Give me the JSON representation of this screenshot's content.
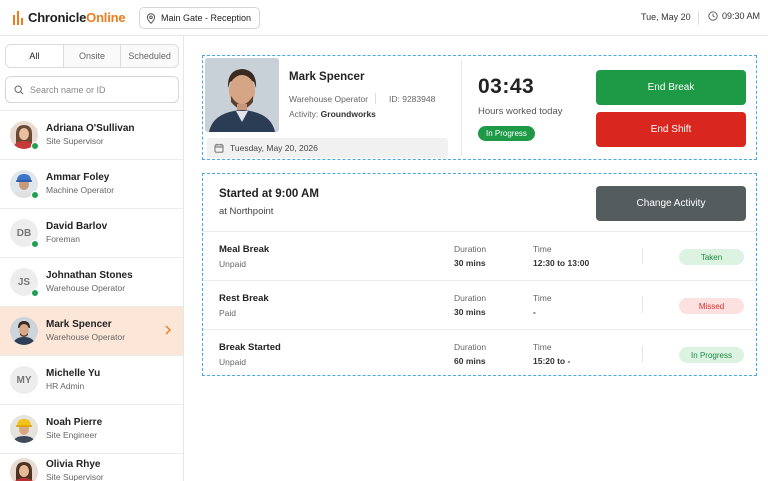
{
  "header": {
    "brand_prefix": "Chronicle",
    "brand_suffix": "Online",
    "location": "Main Gate - Reception",
    "date": "Tue, May 20",
    "time": "09:30 AM"
  },
  "sidebar": {
    "tabs": [
      {
        "label": "All"
      },
      {
        "label": "Onsite"
      },
      {
        "label": "Scheduled"
      }
    ],
    "search_placeholder": "Search name or ID",
    "employees": [
      {
        "name": "Adriana O'Sullivan",
        "role": "Site Supervisor"
      },
      {
        "name": "Ammar Foley",
        "role": "Machine Operator"
      },
      {
        "name": "David Barlov",
        "role": "Foreman",
        "initials": "DB"
      },
      {
        "name": "Johnathan Stones",
        "role": "Warehouse Operator",
        "initials": "JS"
      },
      {
        "name": "Mark Spencer",
        "role": "Warehouse Operator"
      },
      {
        "name": "Michelle Yu",
        "role": "HR Admin",
        "initials": "MY"
      },
      {
        "name": "Noah Pierre",
        "role": "Site Engineer"
      },
      {
        "name": "Olivia Rhye",
        "role": "Site Supervisor"
      }
    ]
  },
  "profile": {
    "name": "Mark Spencer",
    "role": "Warehouse Operator",
    "id_text": "ID: 9283948",
    "activity_label": "Activity:",
    "activity_value": "Groundworks",
    "date": "Tuesday, May 20, 2026"
  },
  "timer": {
    "value": "03:43",
    "label": "Hours worked today",
    "status": "In Progress"
  },
  "actions": {
    "end_break": "End Break",
    "end_shift": "End Shift",
    "change_activity": "Change Activity"
  },
  "shift": {
    "started": "Started at 9:00 AM",
    "location": "at Northpoint"
  },
  "breaks": {
    "duration_label": "Duration",
    "time_label": "Time",
    "rows": [
      {
        "title": "Meal Break",
        "paid": "Unpaid",
        "duration": "30 mins",
        "time": "12:30 to 13:00",
        "status": "Taken"
      },
      {
        "title": "Rest Break",
        "paid": "Paid",
        "duration": "30 mins",
        "time": "-",
        "status": "Missed"
      },
      {
        "title": "Break Started",
        "paid": "Unpaid",
        "duration": "60 mins",
        "time": "15:20 to -",
        "status": "In Progress"
      }
    ]
  },
  "colors": {
    "brand": "#f07b1d",
    "green": "#1e9a47",
    "red": "#d9261e",
    "slate": "#545c5e",
    "selected_row": "#fce6d8"
  }
}
